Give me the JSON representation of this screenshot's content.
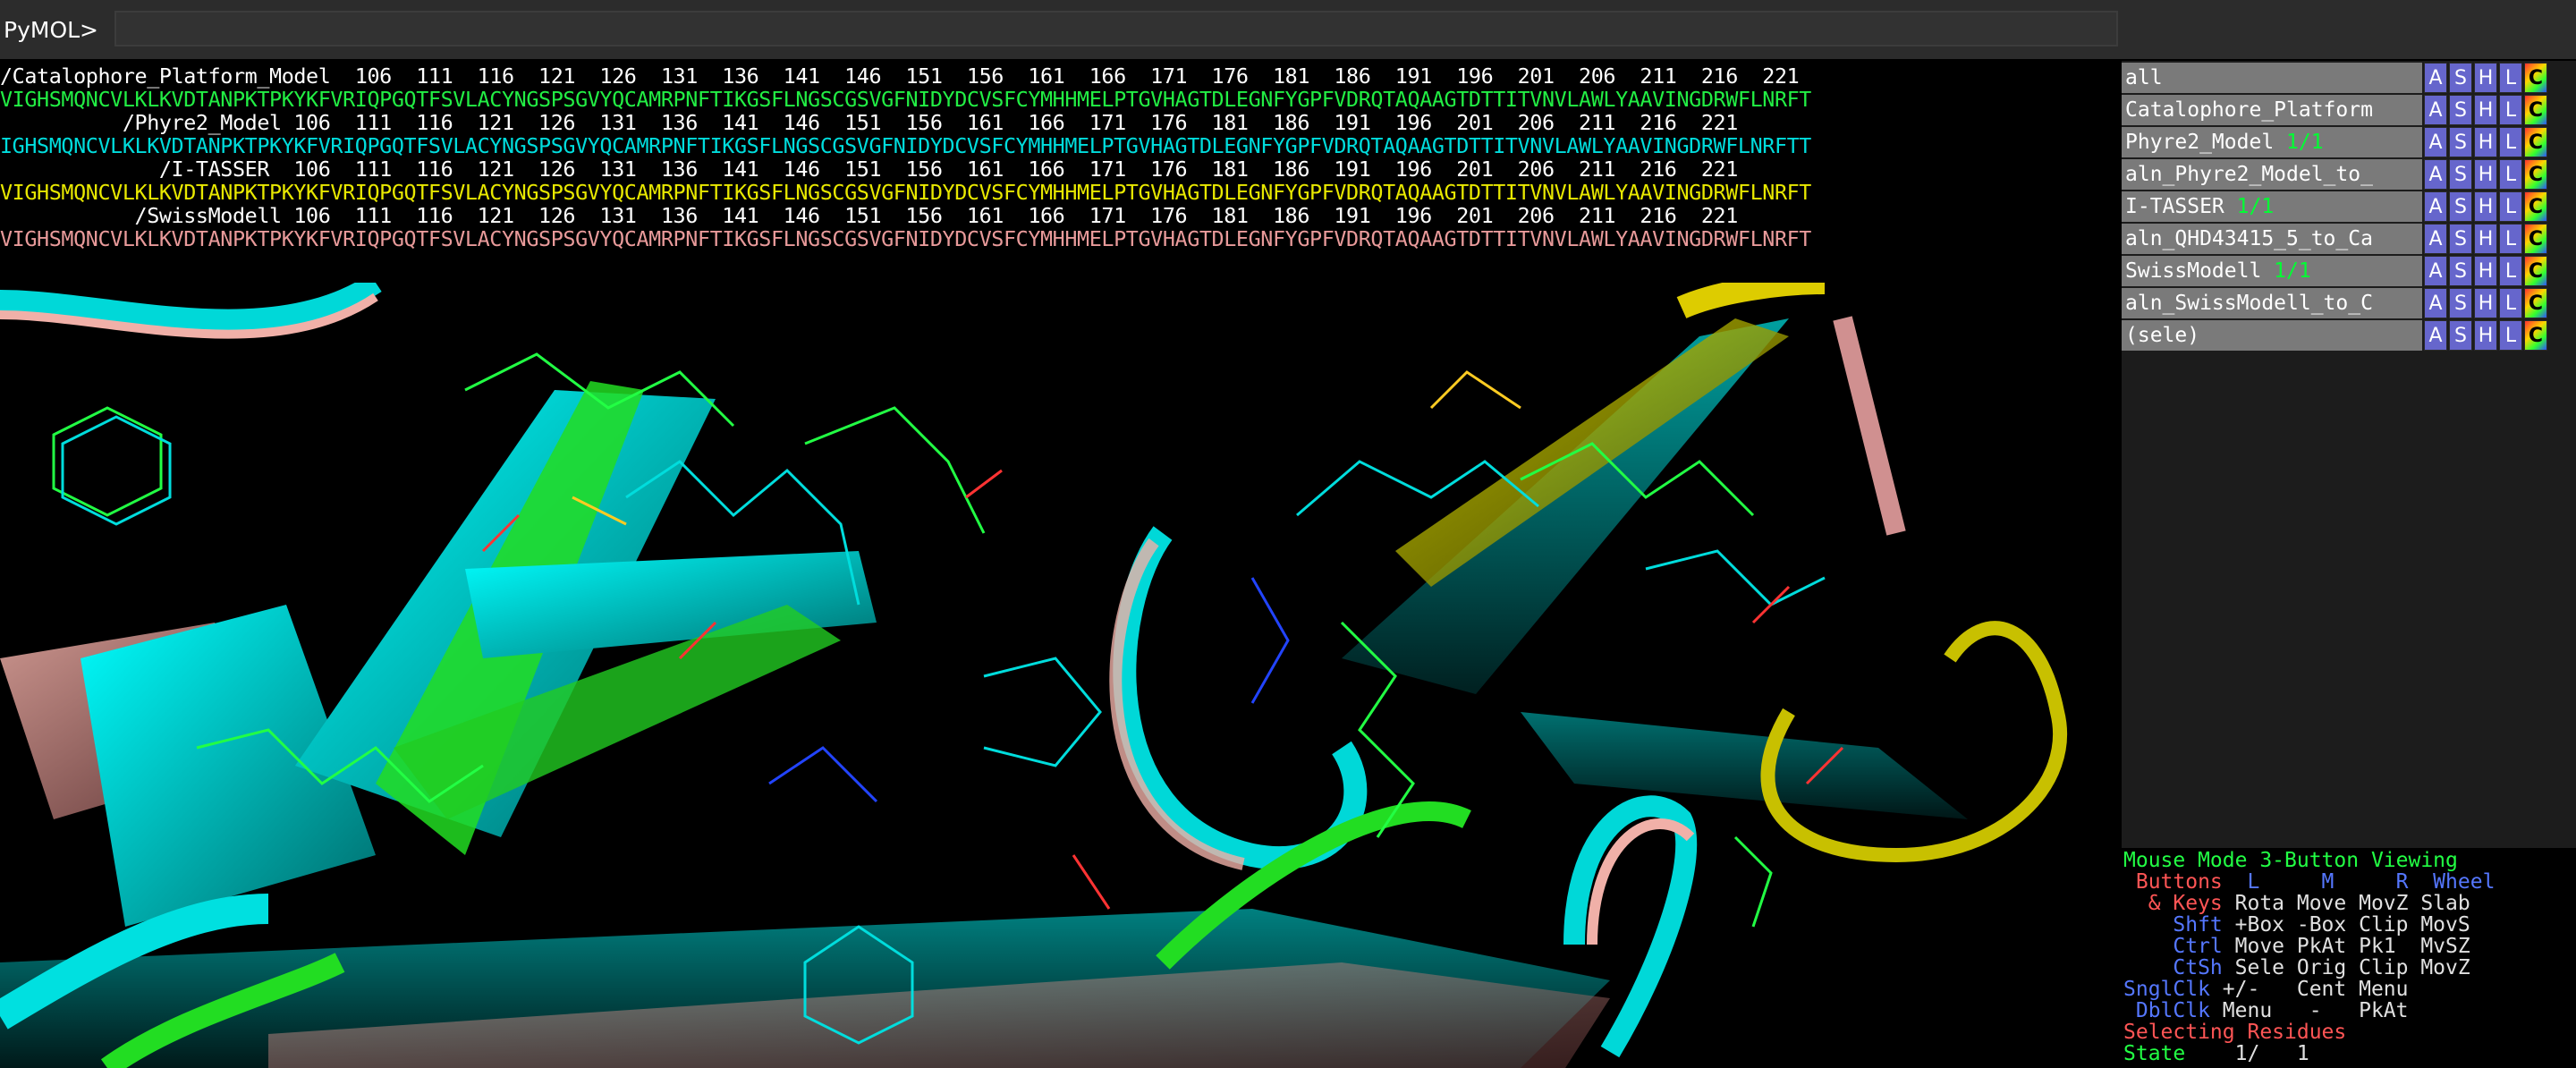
{
  "app": {
    "prompt": "PyMOL>",
    "command_value": ""
  },
  "sequence_viewer": {
    "rows": [
      {
        "kind": "header",
        "text": "/Catalophore_Platform_Model  106  111  116  121  126  131  136  141  146  151  156  161  166  171  176  181  186  191  196  201  206  211  216  221"
      },
      {
        "kind": "seq",
        "color": "#22ee44",
        "text": "VIGHSMQNCVLKLKVDTANPKTPKYKFVRIQPGQTFSVLACYNGSPSGVYQCAMRPNFTIKGSFLNGSCGSVGFNIDYDCVSFCYMHHMELPTGVHAGTDLEGNFYGPFVDRQTAQAAGTDTTITVNVLAWLYAAVINGDRWFLNRFT"
      },
      {
        "kind": "header",
        "text": "          /Phyre2_Model 106  111  116  121  126  131  136  141  146  151  156  161  166  171  176  181  186  191  196  201  206  211  216  221"
      },
      {
        "kind": "seq",
        "color": "#00dddd",
        "text": "IGHSMQNCVLKLKVDTANPKTPKYKFVRIQPGQTFSVLACYNGSPSGVYQCAMRPNFTIKGSFLNGSCGSVGFNIDYDCVSFCYMHHMELPTGVHAGTDLEGNFYGPFVDRQTAQAAGTDTTITVNVLAWLYAAVINGDRWFLNRFTT"
      },
      {
        "kind": "header",
        "text": "             /I-TASSER  106  111  116  121  126  131  136  141  146  151  156  161  166  171  176  181  186  191  196  201  206  211  216  221"
      },
      {
        "kind": "seq",
        "color": "#e8e800",
        "text": "VIGHSMQNCVLKLKVDTANPKTPKYKFVRIQPGQTFSVLACYNGSPSGVYQCAMRPNFTIKGSFLNGSCGSVGFNIDYDCVSFCYMHHMELPTGVHAGTDLEGNFYGPFVDRQTAQAAGTDTTITVNVLAWLYAAVINGDRWFLNRFT"
      },
      {
        "kind": "header",
        "text": "           /SwissModell 106  111  116  121  126  131  136  141  146  151  156  161  166  171  176  181  186  191  196  201  206  211  216  221"
      },
      {
        "kind": "seq",
        "color": "#e89a9a",
        "text": "VIGHSMQNCVLKLKVDTANPKTPKYKFVRIQPGQTFSVLACYNGSPSGVYQCAMRPNFTIKGSFLNGSCGSVGFNIDYDCVSFCYMHHMELPTGVHAGTDLEGNFYGPFVDRQTAQAAGTDTTITVNVLAWLYAAVINGDRWFLNRFT"
      }
    ]
  },
  "objects": [
    {
      "name": "all",
      "state": ""
    },
    {
      "name": "Catalophore_Platform",
      "state": ""
    },
    {
      "name": "Phyre2_Model ",
      "state": "1/1"
    },
    {
      "name": "aln_Phyre2_Model_to_",
      "state": ""
    },
    {
      "name": "I-TASSER ",
      "state": "1/1"
    },
    {
      "name": "aln_QHD43415_5_to_Ca",
      "state": ""
    },
    {
      "name": "SwissModell ",
      "state": "1/1"
    },
    {
      "name": "aln_SwissModell_to_C",
      "state": ""
    },
    {
      "name": "(sele)",
      "state": ""
    }
  ],
  "object_buttons": [
    "A",
    "S",
    "H",
    "L",
    "C"
  ],
  "mouse_panel": {
    "line1": "Mouse Mode 3-Button Viewing",
    "buttons_label": " Buttons",
    "buttons_cols": "  L     M     R  Wheel",
    "keys_label": "  & Keys",
    "keys_vals": " Rota Move MovZ Slab",
    "shft_label": "    Shft",
    "shft_vals": " +Box -Box Clip MovS",
    "ctrl_label": "    Ctrl",
    "ctrl_vals": " Move PkAt Pk1  MvSZ",
    "ctsh_label": "    CtSh",
    "ctsh_vals": " Sele Orig Clip MovZ",
    "sngl_label": "SnglClk",
    "sngl_vals": " +/-   Cent Menu",
    "dbl_label": " DblClk",
    "dbl_vals": " Menu   -   PkAt",
    "selecting": "Selecting Residues",
    "state_label": "State",
    "state_vals": "    1/   1"
  }
}
